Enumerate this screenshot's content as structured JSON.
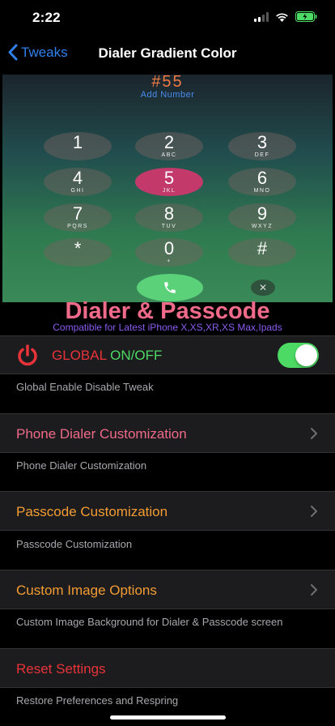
{
  "status": {
    "time": "2:22"
  },
  "nav": {
    "back_label": "Tweaks",
    "title": "Dialer Gradient Color"
  },
  "preview": {
    "number": "#55",
    "add_number": "Add Number",
    "keys": [
      {
        "digit": "1",
        "letters": ""
      },
      {
        "digit": "2",
        "letters": "ABC"
      },
      {
        "digit": "3",
        "letters": "DEF"
      },
      {
        "digit": "4",
        "letters": "GHI"
      },
      {
        "digit": "5",
        "letters": "JKL"
      },
      {
        "digit": "6",
        "letters": "MNO"
      },
      {
        "digit": "7",
        "letters": "PQRS"
      },
      {
        "digit": "8",
        "letters": "TUV"
      },
      {
        "digit": "9",
        "letters": "WXYZ"
      },
      {
        "digit": "*",
        "letters": ""
      },
      {
        "digit": "0",
        "letters": "+"
      },
      {
        "digit": "#",
        "letters": ""
      }
    ],
    "delete_glyph": "✕"
  },
  "banner": {
    "title": "Dialer & Passcode",
    "subtitle": "Compatible for Latest iPhone X,XS,XR,XS Max,Ipads"
  },
  "global": {
    "label_global": "GLOBAL",
    "label_onoff": "ON/OFF",
    "toggle_on": true,
    "footer": "Global Enable Disable Tweak"
  },
  "rows": [
    {
      "label": "Phone Dialer Customization",
      "footer": "Phone Dialer Customization",
      "color": "#f06a8a"
    },
    {
      "label": "Passcode Customization",
      "footer": "Passcode Customization",
      "color": "#f39c33"
    },
    {
      "label": "Custom Image Options",
      "footer": "Custom Image Background for Dialer & Passcode screen",
      "color": "#f39c33"
    }
  ],
  "reset": {
    "label": "Reset Settings",
    "footer": "Restore Preferences and Respring",
    "color": "#e8333a"
  },
  "colors": {
    "accent": "#2f80ed",
    "toggle_on": "#4cd964",
    "power_icon": "#e8333a",
    "global_label": "#e8333a",
    "onoff_label": "#4cd964"
  },
  "icons": [
    "signal-icon",
    "wifi-icon",
    "battery-icon",
    "chevron-left-icon",
    "power-icon",
    "chevron-right-icon",
    "phone-icon"
  ]
}
